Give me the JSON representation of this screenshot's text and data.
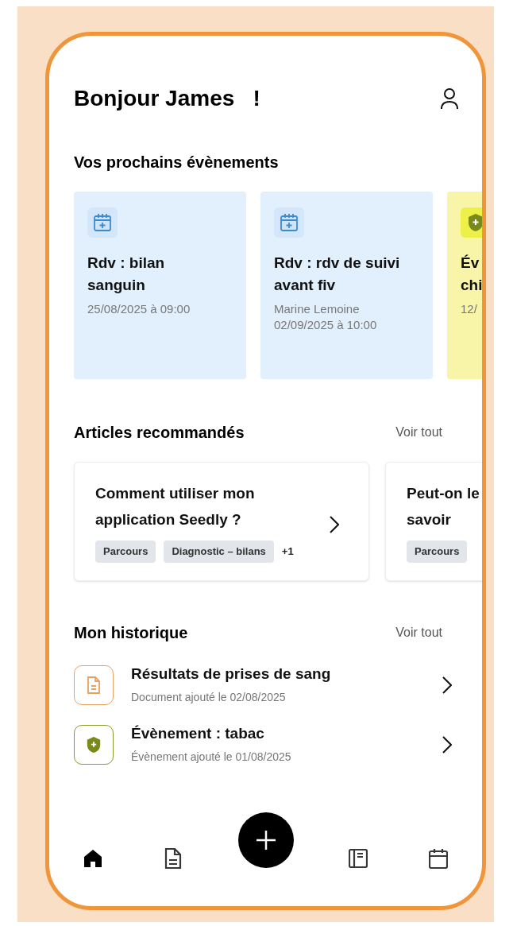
{
  "greeting": "Bonjour James   !",
  "events": {
    "title": "Vos prochains évènements",
    "items": [
      {
        "kind": "appointment",
        "title": "Rdv : bilan sanguin",
        "lines": [
          "25/08/2025 à 09:00"
        ]
      },
      {
        "kind": "appointment",
        "title": "Rdv : rdv de suivi avant fiv",
        "lines": [
          "Marine Lemoine",
          "02/09/2025 à 10:00"
        ]
      },
      {
        "kind": "event",
        "title": "Év chi",
        "lines": [
          "12/"
        ]
      }
    ]
  },
  "articles": {
    "title": "Articles recommandés",
    "link": "Voir tout",
    "items": [
      {
        "title": "Comment utiliser mon application Seedly ?",
        "tags": [
          "Parcours",
          "Diagnostic – bilans"
        ],
        "more": "+1"
      },
      {
        "title": "Peut-on le savoir",
        "tags": [
          "Parcours"
        ]
      }
    ]
  },
  "history": {
    "title": "Mon historique",
    "link": "Voir tout",
    "items": [
      {
        "kind": "document",
        "title": "Résultats de prises de sang",
        "subtitle": "Document ajouté le 02/08/2025"
      },
      {
        "kind": "event",
        "title": "Évènement : tabac",
        "subtitle": "Évènement ajouté le 01/08/2025"
      }
    ]
  },
  "nav": [
    {
      "kind": "home",
      "selected": true
    },
    {
      "kind": "document",
      "selected": false
    },
    {
      "kind": "add",
      "selected": false
    },
    {
      "kind": "journal",
      "selected": false
    },
    {
      "kind": "calendar",
      "selected": false
    }
  ]
}
